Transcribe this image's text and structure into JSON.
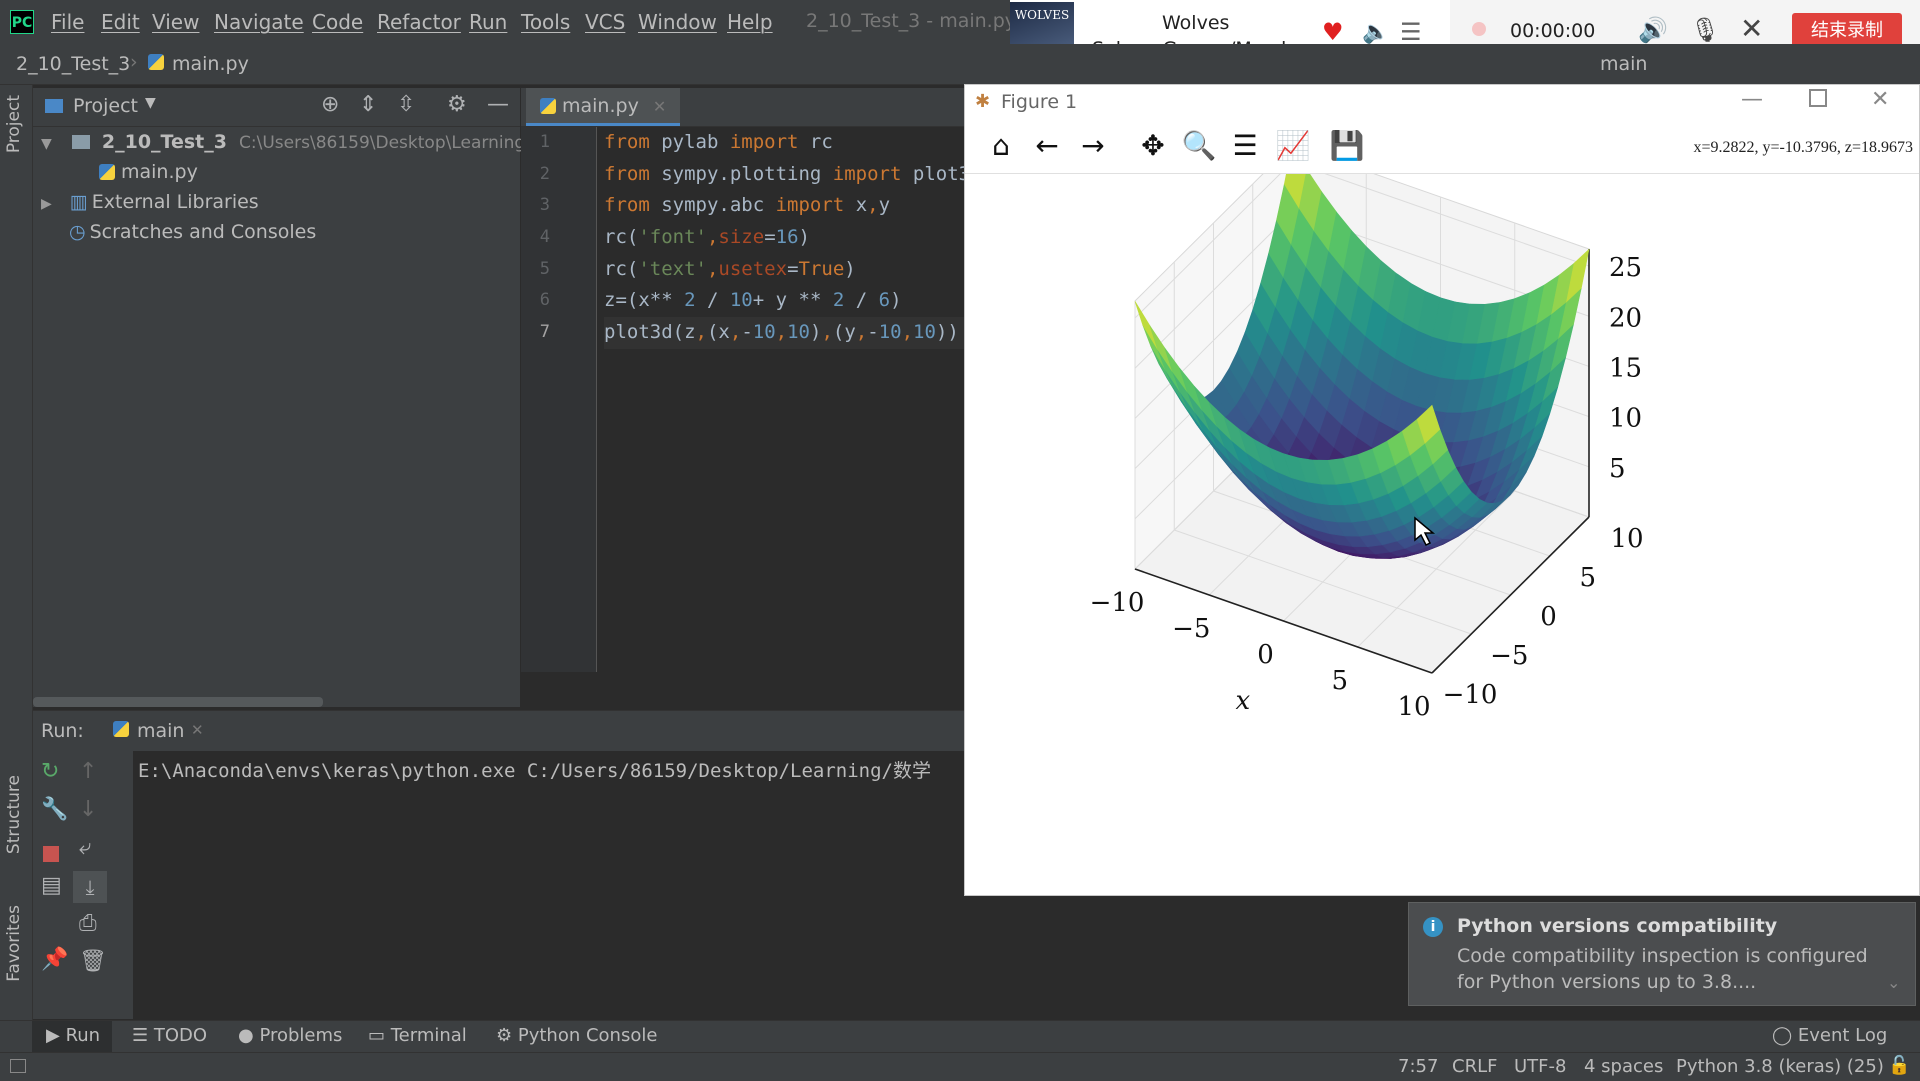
{
  "menubar": {
    "items": [
      "File",
      "Edit",
      "View",
      "Navigate",
      "Code",
      "Refactor",
      "Run",
      "Tools",
      "VCS",
      "Window",
      "Help"
    ],
    "window_title": "2_10_Test_3 - main.py"
  },
  "navbar": {
    "project": "2_10_Test_3",
    "file": "main.py",
    "run_config": "main"
  },
  "music": {
    "cover_text": "WOLVES",
    "title": "Wolves",
    "artist": "Selena Gomez/Marsh..."
  },
  "recorder": {
    "time": "00:00:00",
    "stop_label": "结束录制"
  },
  "left_strip": {
    "project_label": "Project",
    "structure_label": "Structure",
    "favorites_label": "Favorites"
  },
  "project_panel": {
    "title": "Project",
    "root_name": "2_10_Test_3",
    "root_path": "C:\\Users\\86159\\Desktop\\Learning\\",
    "file": "main.py",
    "external": "External Libraries",
    "scratches": "Scratches and Consoles"
  },
  "editor": {
    "tab": "main.py",
    "line_numbers": [
      "1",
      "2",
      "3",
      "4",
      "5",
      "6",
      "7"
    ]
  },
  "run": {
    "label": "Run:",
    "tab": "main",
    "command": "E:\\Anaconda\\envs\\keras\\python.exe C:/Users/86159/Desktop/Learning/数学"
  },
  "figure": {
    "title": "Figure 1",
    "coords": "x=9.2822,  y=-10.3796,  z=18.9673"
  },
  "chart_data": {
    "type": "surface3d",
    "function": "z = x**2/10 + y**2/6",
    "x_range": [
      -10,
      10
    ],
    "y_range": [
      -10,
      10
    ],
    "z_range": [
      0,
      26.7
    ],
    "x_ticks": [
      "−10",
      "−5",
      "0",
      "5",
      "10"
    ],
    "y_ticks": [
      "−10",
      "−5",
      "0",
      "5",
      "10"
    ],
    "z_ticks": [
      "5",
      "10",
      "15",
      "20",
      "25"
    ],
    "xlabel": "x",
    "ylabel": "",
    "colormap": "viridis"
  },
  "notification": {
    "title": "Python versions compatibility",
    "body_line1": "Code compatibility inspection is configured",
    "body_line2": "for Python versions up to 3.8...."
  },
  "toolwindows": [
    "Run",
    "TODO",
    "Problems",
    "Terminal",
    "Python Console"
  ],
  "event_log": "Event Log",
  "status": {
    "position": "7:57",
    "line_sep": "CRLF",
    "encoding": "UTF-8",
    "indent": "4 spaces",
    "interpreter": "Python 3.8 (keras) (25)"
  }
}
